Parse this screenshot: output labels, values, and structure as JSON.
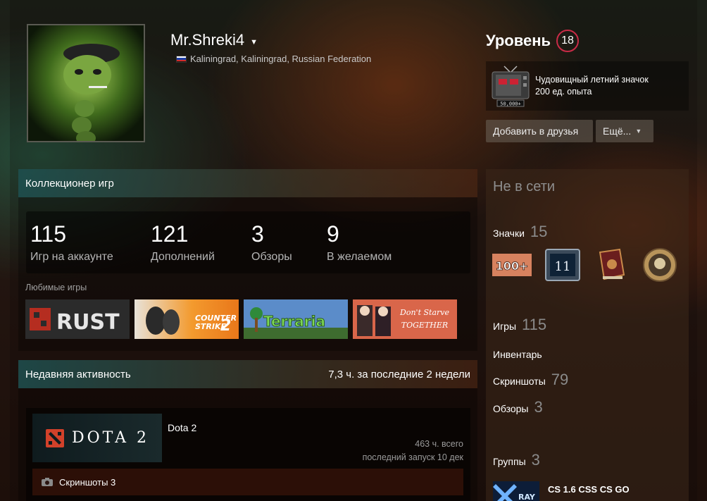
{
  "profile": {
    "name": "Mr.Shreki4",
    "location": "Kaliningrad, Kaliningrad, Russian Federation"
  },
  "level": {
    "label": "Уровень",
    "value": "18"
  },
  "favorite_badge": {
    "name": "Чудовищный летний значок",
    "xp": "200 ед. опыта",
    "icon_text": "50,000+"
  },
  "actions": {
    "add_friend": "Добавить в друзья",
    "more": "Ещё..."
  },
  "collector": {
    "title": "Коллекционер игр",
    "stats": [
      {
        "num": "115",
        "label": "Игр на аккаунте"
      },
      {
        "num": "121",
        "label": "Дополнений"
      },
      {
        "num": "3",
        "label": "Обзоры"
      },
      {
        "num": "9",
        "label": "В желаемом"
      }
    ],
    "favorites_label": "Любимые игры",
    "games": [
      {
        "name": "RUST",
        "icon": "rust-logo"
      },
      {
        "name": "COUNTER STRIKE 2",
        "icon": "cs2-logo"
      },
      {
        "name": "Terraria",
        "icon": "terraria-logo"
      },
      {
        "name": "Don't Starve Together",
        "icon": "dst-logo"
      }
    ]
  },
  "activity": {
    "title": "Недавняя активность",
    "summary": "7,3 ч. за последние 2 недели",
    "game": {
      "logo_text": "DOTA 2",
      "name": "Dota 2",
      "total": "463 ч. всего",
      "last_played": "последний запуск 10 дек"
    },
    "screenshots": "Скриншоты 3"
  },
  "sidebar": {
    "status": "Не в сети",
    "badges_label": "Значки",
    "badges_count": "15",
    "badge_items": [
      {
        "icon": "100plus-badge-icon",
        "text": "100+"
      },
      {
        "icon": "eleven-badge-icon",
        "text": "11"
      },
      {
        "icon": "book-badge-icon"
      },
      {
        "icon": "bronze-medal-badge-icon"
      }
    ],
    "games_label": "Игры",
    "games_count": "115",
    "inventory_label": "Инвентарь",
    "screenshots_label": "Скриншоты",
    "screenshots_count": "79",
    "reviews_label": "Обзоры",
    "reviews_count": "3",
    "groups_label": "Группы",
    "groups_count": "3",
    "group": {
      "name": "CS 1.6 CSS CS GO"
    }
  },
  "colors": {
    "level_ring": "#c92b47",
    "muted_text": "#8b8b8b"
  }
}
